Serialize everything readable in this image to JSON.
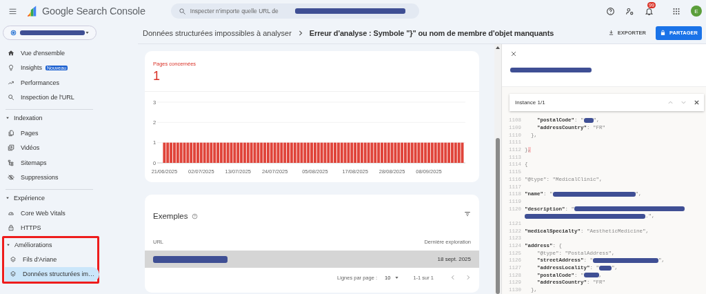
{
  "topbar": {
    "app_name": "Google Search Console",
    "search": {
      "placeholder": "Inspecter n'importe quelle URL de"
    },
    "notifications_badge": "99",
    "avatar_letter": "E"
  },
  "sidebar": {
    "top_items": [
      {
        "label": "Vue d'ensemble",
        "selected": false
      },
      {
        "label": "Insights",
        "selected": false,
        "badge": "Nouveau"
      },
      {
        "label": "Performances",
        "selected": false
      },
      {
        "label": "Inspection de l'URL",
        "selected": false
      }
    ],
    "sections": [
      {
        "title": "Indexation",
        "expanded": true,
        "highlighted": false,
        "items": [
          {
            "label": "Pages",
            "selected": false
          },
          {
            "label": "Vidéos",
            "selected": false
          },
          {
            "label": "Sitemaps",
            "selected": false
          },
          {
            "label": "Suppressions",
            "selected": false
          }
        ]
      },
      {
        "title": "Expérience",
        "expanded": true,
        "highlighted": false,
        "items": [
          {
            "label": "Core Web Vitals",
            "selected": false
          },
          {
            "label": "HTTPS",
            "selected": false
          }
        ]
      },
      {
        "title": "Améliorations",
        "expanded": true,
        "highlighted": true,
        "items": [
          {
            "label": "Fils d'Ariane",
            "selected": false
          },
          {
            "label": "Données structurées im…",
            "selected": true
          }
        ]
      }
    ]
  },
  "breadcrumb": {
    "parent": "Données structurées impossibles à analyser",
    "current": "Erreur d'analyse : Symbole \"}\" ou nom de membre d'objet manquants"
  },
  "actions": [
    {
      "label": "EXPORTER",
      "kind": "text"
    },
    {
      "label": "PARTAGER",
      "kind": "primary"
    }
  ],
  "summary": {
    "label": "Pages concernées",
    "value": "1",
    "chart_data": {
      "type": "bar",
      "ylim": [
        0,
        3
      ],
      "yticks": [
        0,
        1,
        2,
        3
      ],
      "categories": [
        "21/06/2025",
        null,
        null,
        null,
        null,
        null,
        null,
        null,
        null,
        null,
        null,
        "02/07/2025",
        null,
        null,
        null,
        null,
        null,
        null,
        null,
        null,
        null,
        null,
        "13/07/2025",
        null,
        null,
        null,
        null,
        null,
        null,
        null,
        null,
        null,
        null,
        "24/07/2025",
        null,
        null,
        null,
        null,
        null,
        null,
        null,
        null,
        null,
        null,
        null,
        "05/08/2025",
        null,
        null,
        null,
        null,
        null,
        null,
        null,
        null,
        null,
        null,
        null,
        "17/08/2025",
        null,
        null,
        null,
        null,
        null,
        null,
        null,
        null,
        null,
        null,
        "28/08/2025",
        null,
        null,
        null,
        null,
        null,
        null,
        null,
        null,
        null,
        null,
        "08/09/2025",
        null,
        null,
        null,
        null,
        null,
        null,
        null,
        null,
        null,
        null
      ],
      "series": [
        {
          "color": "#e0443a",
          "values": [
            1,
            1,
            1,
            1,
            1,
            1,
            1,
            1,
            1,
            1,
            1,
            1,
            1,
            1,
            1,
            1,
            1,
            1,
            1,
            1,
            1,
            1,
            1,
            1,
            1,
            1,
            1,
            1,
            1,
            1,
            1,
            1,
            1,
            1,
            1,
            1,
            1,
            1,
            1,
            1,
            1,
            1,
            1,
            1,
            1,
            1,
            1,
            1,
            1,
            1,
            1,
            1,
            1,
            1,
            1,
            1,
            1,
            1,
            1,
            1,
            1,
            1,
            1,
            1,
            1,
            1,
            1,
            1,
            1,
            1,
            1,
            1,
            1,
            1,
            1,
            1,
            1,
            1,
            1,
            1,
            1,
            1,
            1,
            1,
            1,
            1,
            1,
            1,
            1,
            1
          ]
        }
      ]
    }
  },
  "examples": {
    "title": "Exemples",
    "columns": [
      "URL",
      "Dernière exploration"
    ],
    "rows": [
      {
        "highlighted": true,
        "date": "18 sept. 2025"
      }
    ],
    "pagination": {
      "rows_label": "Lignes par page :",
      "rows_per_page": "10",
      "range": "1-1 sur 1"
    }
  },
  "code_panel": {
    "search": {
      "label": "Instance 1/1"
    },
    "lines": [
      {
        "num": "1108",
        "tokens": [
          {
            "kind": "key",
            "text": "    \"postalCode\""
          },
          {
            "kind": "punct",
            "text": ": \""
          },
          {
            "kind": "redacted"
          },
          {
            "kind": "punct",
            "text": "\","
          }
        ]
      },
      {
        "num": "1109",
        "tokens": [
          {
            "kind": "key",
            "text": "    \"addressCountry\""
          },
          {
            "kind": "str",
            "text": ": \"FR\""
          }
        ]
      },
      {
        "num": "1110",
        "tokens": [
          {
            "kind": "punct",
            "text": "  },"
          }
        ]
      },
      {
        "num": "1111"
      },
      {
        "num": "1112",
        "tokens": [
          {
            "kind": "punct",
            "text": "}"
          },
          {
            "kind": "error",
            "text": ","
          }
        ]
      },
      {
        "num": "1113"
      },
      {
        "num": "1114",
        "tokens": [
          {
            "kind": "punct",
            "text": "{"
          }
        ]
      },
      {
        "num": "1115"
      },
      {
        "num": "1116",
        "tokens": [
          {
            "kind": "str",
            "text": "\"@type\": \"MedicalClinic\","
          }
        ]
      },
      {
        "num": "1117"
      },
      {
        "num": "1118",
        "tokens": [
          {
            "kind": "key",
            "text": "\"name\""
          },
          {
            "kind": "punct",
            "text": ": \""
          },
          {
            "kind": "redacted"
          },
          {
            "kind": "punct",
            "text": "\","
          }
        ]
      },
      {
        "num": "1119"
      },
      {
        "num": "1120",
        "tokens": [
          {
            "kind": "key",
            "text": "\"description\""
          },
          {
            "kind": "punct",
            "text": ": \""
          },
          {
            "kind": "redacted"
          }
        ]
      },
      {
        "tokens": [
          {
            "kind": "redacted"
          },
          {
            "kind": "punct",
            "text": ".\","
          }
        ]
      },
      {
        "num": "1121"
      },
      {
        "num": "1122",
        "tokens": [
          {
            "kind": "key",
            "text": "\"medicalSpecialty\""
          },
          {
            "kind": "str",
            "text": ": \"AestheticMedicine\","
          }
        ]
      },
      {
        "num": "1123"
      },
      {
        "num": "1124",
        "tokens": [
          {
            "kind": "key",
            "text": "\"address\""
          },
          {
            "kind": "punct",
            "text": ": {"
          }
        ]
      },
      {
        "num": "1125",
        "tokens": [
          {
            "kind": "str",
            "text": "    \"@type\": \"PostalAddress\","
          }
        ]
      },
      {
        "num": "1126",
        "tokens": [
          {
            "kind": "key",
            "text": "    \"streetAddress\""
          },
          {
            "kind": "punct",
            "text": ": \""
          },
          {
            "kind": "redacted"
          },
          {
            "kind": "punct",
            "text": "\","
          }
        ]
      },
      {
        "num": "1127",
        "tokens": [
          {
            "kind": "key",
            "text": "    \"addressLocality\""
          },
          {
            "kind": "punct",
            "text": ": \""
          },
          {
            "kind": "redacted"
          },
          {
            "kind": "punct",
            "text": "\","
          }
        ]
      },
      {
        "num": "1128",
        "tokens": [
          {
            "kind": "key",
            "text": "    \"postalCode\""
          },
          {
            "kind": "punct",
            "text": ": \""
          },
          {
            "kind": "redacted"
          },
          {
            "kind": "punct",
            "text": ","
          }
        ]
      },
      {
        "num": "1129",
        "tokens": [
          {
            "kind": "key",
            "text": "    \"addressCountry\""
          },
          {
            "kind": "str",
            "text": ": \"FR\""
          }
        ]
      },
      {
        "num": "1130",
        "tokens": [
          {
            "kind": "punct",
            "text": "  },"
          }
        ]
      }
    ]
  }
}
